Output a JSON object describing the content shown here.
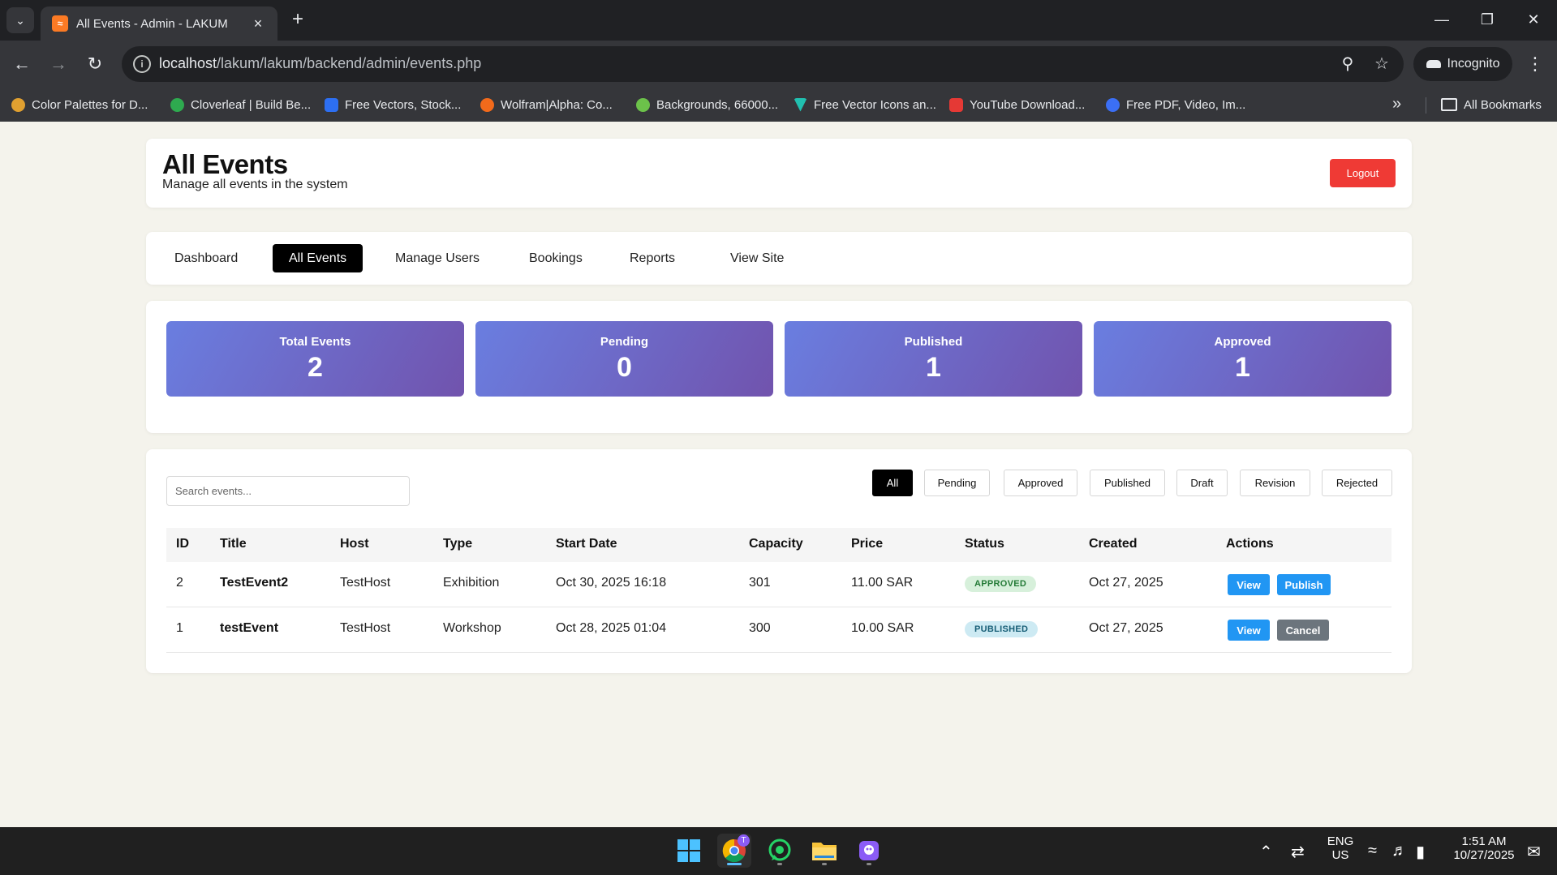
{
  "browser": {
    "tab_title": "All Events - Admin - LAKUM",
    "tab_favicon": "xampp-icon",
    "url_host": "localhost",
    "url_path": "/lakum/lakum/backend/admin/events.php",
    "incognito_label": "Incognito",
    "bookmarks": [
      {
        "label": "Color Palettes for D...",
        "icon": "bookmark-favicon",
        "color": "#e0a030"
      },
      {
        "label": "Cloverleaf | Build Be...",
        "icon": "cloverleaf-icon",
        "color": "#2eaa4f"
      },
      {
        "label": "Free Vectors, Stock...",
        "icon": "freepik-icon",
        "color": "#2d6ff2"
      },
      {
        "label": "Wolfram|Alpha: Co...",
        "icon": "wolfram-icon",
        "color": "#f26a1b"
      },
      {
        "label": "Backgrounds, 66000...",
        "icon": "backgrounds-icon",
        "color": "#6cc24a"
      },
      {
        "label": "Free Vector Icons an...",
        "icon": "vector-icon",
        "color": "#21c0b0"
      },
      {
        "label": "YouTube Download...",
        "icon": "download-icon",
        "color": "#e53935"
      },
      {
        "label": "Free PDF, Video, Im...",
        "icon": "pdf-tool-icon",
        "color": "#3b6ff5"
      }
    ],
    "all_bookmarks_label": "All Bookmarks"
  },
  "header": {
    "title": "All Events",
    "subtitle": "Manage all events in the system",
    "logout_label": "Logout"
  },
  "nav": {
    "items": [
      {
        "label": "Dashboard",
        "active": false
      },
      {
        "label": "All Events",
        "active": true
      },
      {
        "label": "Manage Users",
        "active": false
      },
      {
        "label": "Bookings",
        "active": false
      },
      {
        "label": "Reports",
        "active": false
      },
      {
        "label": "View Site",
        "active": false
      }
    ]
  },
  "stats": [
    {
      "label": "Total Events",
      "value": "2"
    },
    {
      "label": "Pending",
      "value": "0"
    },
    {
      "label": "Published",
      "value": "1"
    },
    {
      "label": "Approved",
      "value": "1"
    }
  ],
  "search": {
    "placeholder": "Search events..."
  },
  "filters": [
    {
      "label": "All",
      "active": true
    },
    {
      "label": "Pending",
      "active": false
    },
    {
      "label": "Approved",
      "active": false
    },
    {
      "label": "Published",
      "active": false
    },
    {
      "label": "Draft",
      "active": false
    },
    {
      "label": "Revision",
      "active": false
    },
    {
      "label": "Rejected",
      "active": false
    }
  ],
  "table": {
    "columns": [
      "ID",
      "Title",
      "Host",
      "Type",
      "Start Date",
      "Capacity",
      "Price",
      "Status",
      "Created",
      "Actions"
    ],
    "rows": [
      {
        "id": "2",
        "title": "TestEvent2",
        "host": "TestHost",
        "type": "Exhibition",
        "start_date": "Oct 30, 2025 16:18",
        "capacity": "301",
        "price": "11.00 SAR",
        "status": "APPROVED",
        "created": "Oct 27, 2025",
        "actions": [
          "View",
          "Publish"
        ]
      },
      {
        "id": "1",
        "title": "testEvent",
        "host": "TestHost",
        "type": "Workshop",
        "start_date": "Oct 28, 2025 01:04",
        "capacity": "300",
        "price": "10.00 SAR",
        "status": "PUBLISHED",
        "created": "Oct 27, 2025",
        "actions": [
          "View",
          "Cancel"
        ]
      }
    ]
  },
  "taskbar": {
    "language": "ENG",
    "region": "US",
    "time": "1:51 AM",
    "date": "10/27/2025",
    "chrome_profile_badge": "T"
  },
  "colors": {
    "accent_logout": "#ef3a35",
    "stat_gradient": [
      "#6a7ee0",
      "#7153ad"
    ],
    "action_blue": "#2196f3",
    "cancel_gray": "#6c757d"
  }
}
